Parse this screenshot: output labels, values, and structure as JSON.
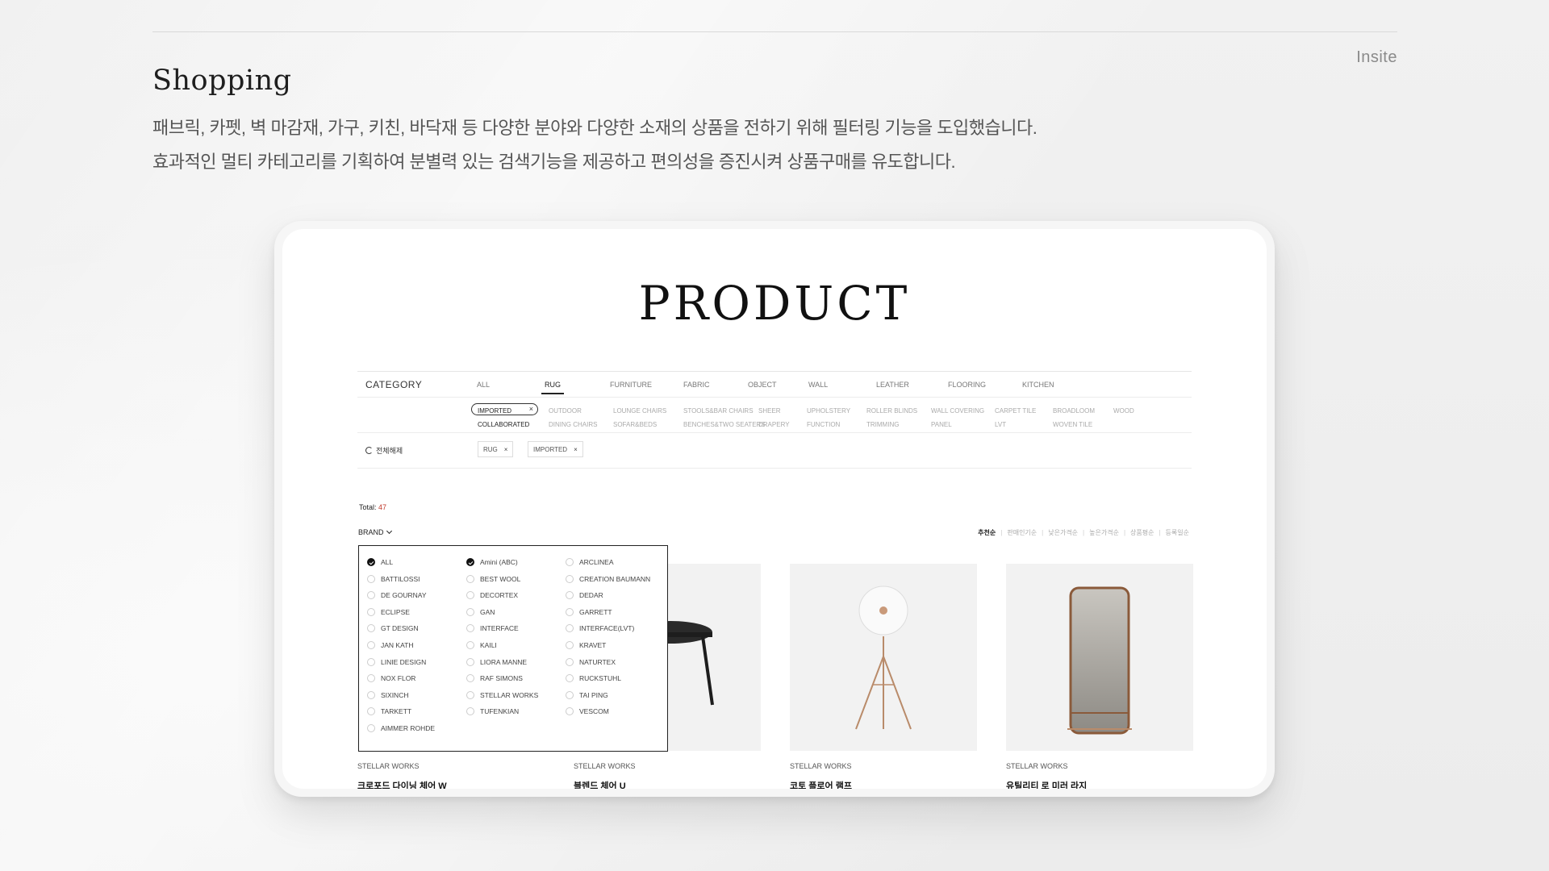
{
  "page": {
    "brand": "Insite",
    "heading": "Shopping",
    "desc_line1": "패브릭, 카펫, 벽 마감재, 가구, 키친, 바닥재 등 다양한 분야와 다양한 소재의 상품을 전하기 위해 필터링 기능을 도입했습니다.",
    "desc_line2": "효과적인 멀티 카테고리를 기획하여 분별력 있는 검색기능을 제공하고 편의성을 증진시켜 상품구매를 유도합니다."
  },
  "screen": {
    "title": "PRODUCT",
    "category_label": "CATEGORY",
    "categories": [
      "ALL",
      "RUG",
      "FURNITURE",
      "FABRIC",
      "OBJECT",
      "WALL",
      "LEATHER",
      "FLOORING",
      "KITCHEN"
    ],
    "active_category": "RUG",
    "subcategories_row1": [
      "IMPORTED",
      "OUTDOOR",
      "LOUNGE CHAIRS",
      "STOOLS&BAR CHAIRS",
      "SHEER",
      "UPHOLSTERY",
      "ROLLER BLINDS",
      "WALL COVERING",
      "CARPET TILE",
      "BROADLOOM",
      "WOOD"
    ],
    "subcategories_row2": [
      "COLLABORATED",
      "DINING CHAIRS",
      "SOFAR&BEDS",
      "BENCHES&TWO SEATERS",
      "DRAPERY",
      "FUNCTION",
      "TRIMMING",
      "PANEL",
      "LVT",
      "WOVEN TILE"
    ],
    "pill_x": "×",
    "reset_label": "전체해제",
    "selected_chips": [
      {
        "label": "RUG",
        "x": "×"
      },
      {
        "label": "IMPORTED",
        "x": "×"
      }
    ],
    "total_label": "Total:",
    "total_count": "47",
    "brand_dropdown_label": "BRAND",
    "sort_options": [
      "추천순",
      "판매인기순",
      "낮은가격순",
      "높은가격순",
      "상품평순",
      "등록일순"
    ],
    "sort_active": "추천순",
    "brand_options_col1": [
      "ALL",
      "BATTILOSSI",
      "DE GOURNAY",
      "ECLIPSE",
      "GT DESIGN",
      "JAN KATH",
      "LINIE DESIGN",
      "NOX FLOR",
      "SIXINCH",
      "TARKETT",
      "AIMMER ROHDE"
    ],
    "brand_options_col2": [
      "Amini (ABC)",
      "BEST WOOL",
      "DECORTEX",
      "GAN",
      "INTERFACE",
      "KAILI",
      "LIORA MANNE",
      "RAF SIMONS",
      "STELLAR WORKS",
      "TUFENKIAN"
    ],
    "brand_options_col3": [
      "ARCLINEA",
      "CREATION BAUMANN",
      "DEDAR",
      "GARRETT",
      "INTERFACE(LVT)",
      "KRAVET",
      "NATURTEX",
      "RUCKSTUHL",
      "TAI PING",
      "VESCOM"
    ],
    "checked_brands": [
      "ALL",
      "Amini (ABC)"
    ],
    "products": [
      {
        "brand": "STELLAR WORKS",
        "name": "크로포드 다이닝 체어 W",
        "icon": "dining-chair"
      },
      {
        "brand": "STELLAR WORKS",
        "name": "블렌드 체어 U",
        "icon": "round-table"
      },
      {
        "brand": "STELLAR WORKS",
        "name": "코토 플로어 램프",
        "icon": "floor-lamp"
      },
      {
        "brand": "STELLAR WORKS",
        "name": "유틸리티 로 미러 라지",
        "icon": "floor-mirror"
      }
    ]
  },
  "colors": {
    "accent_total": "#c0392b",
    "page_bg": "#efefef"
  }
}
